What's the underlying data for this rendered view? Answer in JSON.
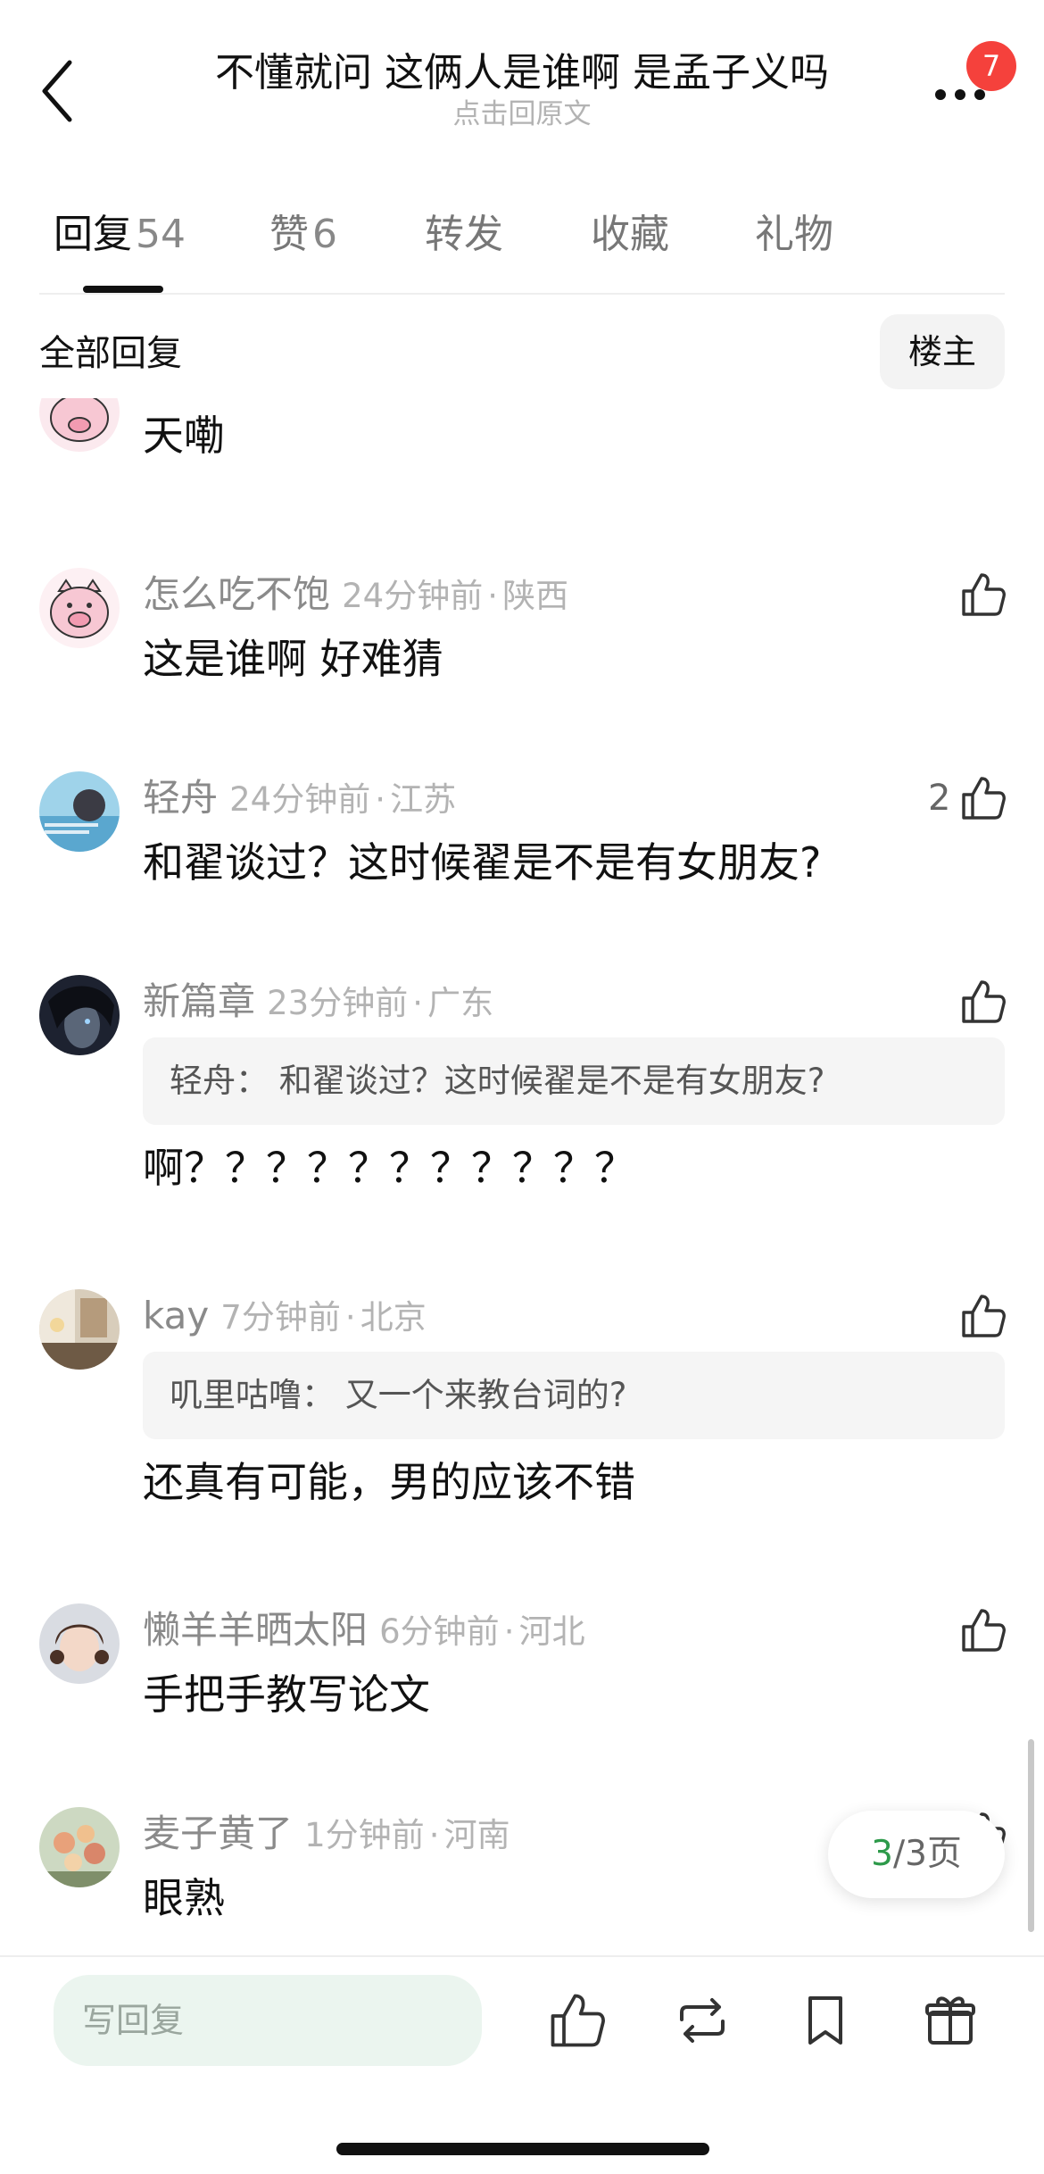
{
  "header": {
    "title": "不懂就问 这俩人是谁啊 是孟子义吗",
    "subtitle": "点击回原文",
    "notification_count": "7"
  },
  "tabs": [
    {
      "label": "回复",
      "count": "54",
      "active": true
    },
    {
      "label": "赞",
      "count": "6",
      "active": false
    },
    {
      "label": "转发",
      "count": "",
      "active": false
    },
    {
      "label": "收藏",
      "count": "",
      "active": false
    },
    {
      "label": "礼物",
      "count": "",
      "active": false
    }
  ],
  "filter": {
    "label": "全部回复",
    "owner_only_label": "楼主"
  },
  "comments": [
    {
      "text": "天嘞",
      "avatar": "pig-avatar"
    },
    {
      "user": "怎么吃不饱",
      "time": "24分钟前",
      "location": "陕西",
      "text": "这是谁啊  好难猜",
      "avatar": "pig-avatar"
    },
    {
      "user": "轻舟",
      "time": "24分钟前",
      "location": "江苏",
      "text": "和翟谈过？这时候翟是不是有女朋友?",
      "likes": "2",
      "avatar": "blue-photo-avatar"
    },
    {
      "user": "新篇章",
      "time": "23分钟前",
      "location": "广东",
      "quote": "轻舟：  和翟谈过？这时候翟是不是有女朋友?",
      "text": "啊？？？？？？？？？？？",
      "avatar": "dark-portrait-avatar"
    },
    {
      "user": "kay",
      "time": "7分钟前",
      "location": "北京",
      "quote": "叽里咕噜：  又一个来教台词的?",
      "text": "还真有可能，男的应该不错",
      "avatar": "room-photo-avatar"
    },
    {
      "user": "懒羊羊晒太阳",
      "time": "6分钟前",
      "location": "河北",
      "text": "手把手教写论文",
      "avatar": "girl-portrait-avatar"
    },
    {
      "user": "麦子黄了",
      "time": "1分钟前",
      "location": "河南",
      "text": "眼熟",
      "avatar": "flowers-avatar"
    }
  ],
  "pager": {
    "current": "3",
    "rest": "/3页"
  },
  "bottom_bar": {
    "reply_placeholder": "写回复",
    "icons": [
      "like-icon",
      "repost-icon",
      "bookmark-icon",
      "gift-icon"
    ]
  }
}
